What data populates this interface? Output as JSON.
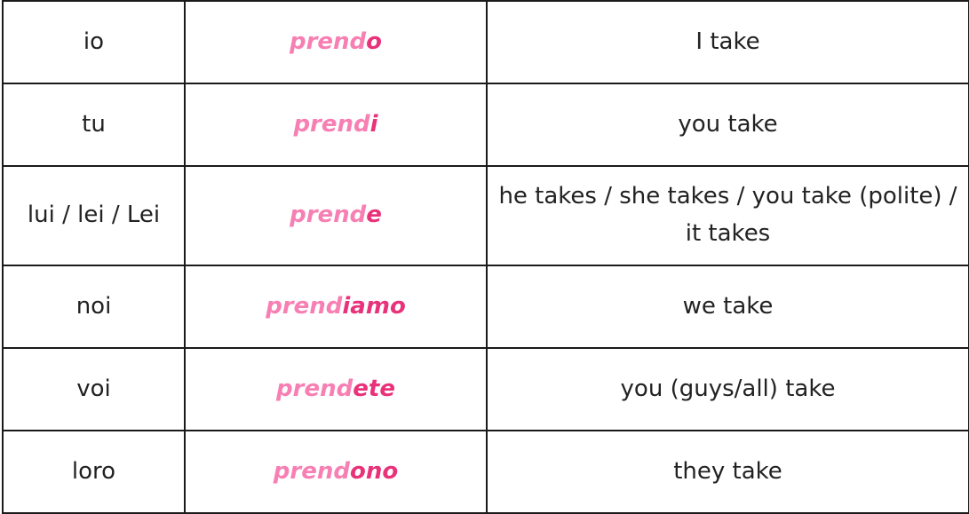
{
  "table": {
    "rows": [
      {
        "pronoun": "io",
        "stem": "prend",
        "ending": "o",
        "translation": "I take"
      },
      {
        "pronoun": "tu",
        "stem": "prend",
        "ending": "i",
        "translation": "you take"
      },
      {
        "pronoun": "lui / lei / Lei",
        "stem": "prend",
        "ending": "e",
        "translation": "he takes / she takes / you take (polite) / it takes"
      },
      {
        "pronoun": "noi",
        "stem": "prend",
        "ending": "iamo",
        "translation": "we take"
      },
      {
        "pronoun": "voi",
        "stem": "prend",
        "ending": "ete",
        "translation": "you (guys/all) take"
      },
      {
        "pronoun": "loro",
        "stem": "prend",
        "ending": "ono",
        "translation": "they take"
      }
    ]
  },
  "colors": {
    "stem": "#f77fb3",
    "ending": "#e8327a",
    "text": "#222222",
    "border": "#1a1a1a"
  }
}
